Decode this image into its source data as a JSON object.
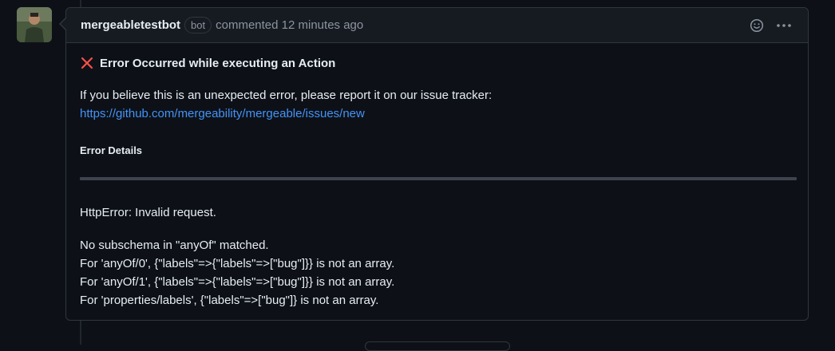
{
  "comment": {
    "author": "mergeabletestbot",
    "badge": "bot",
    "meta": "commented 12 minutes ago",
    "error_title": "Error Occurred while executing an Action",
    "intro": "If you believe this is an unexpected error, please report it on our issue tracker:",
    "link": "https://github.com/mergeability/mergeable/issues/new",
    "details_heading": "Error Details",
    "http_error": "HttpError: Invalid request.",
    "detail_lines": [
      "No subschema in \"anyOf\" matched.",
      "For 'anyOf/0', {\"labels\"=>{\"labels\"=>[\"bug\"]}} is not an array.",
      "For 'anyOf/1', {\"labels\"=>{\"labels\"=>[\"bug\"]}} is not an array.",
      "For 'properties/labels', {\"labels\"=>[\"bug\"]} is not an array."
    ]
  },
  "icons": {
    "avatar": "user-avatar",
    "error": "x-icon",
    "reaction": "smiley-icon",
    "menu": "kebab-horizontal-icon"
  },
  "colors": {
    "background": "#0d1117",
    "header": "#161b22",
    "border": "#30363d",
    "link": "#4493f8",
    "error": "#f85149",
    "muted": "#8b949e"
  }
}
